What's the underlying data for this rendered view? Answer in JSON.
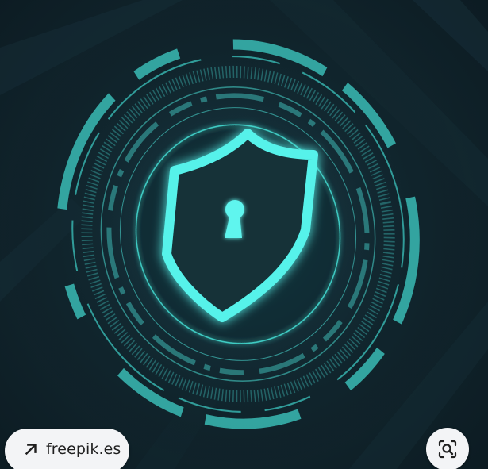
{
  "image": {
    "alt": "",
    "accent_color": "#3fe0d8",
    "background_color": "#12272f",
    "glyphs": [
      "shield-icon",
      "keyhole-icon"
    ]
  },
  "source_chip": {
    "label": "freepik.es",
    "icon": "arrow-up-right-icon"
  },
  "lens_button": {
    "icon": "visual-search-icon"
  }
}
